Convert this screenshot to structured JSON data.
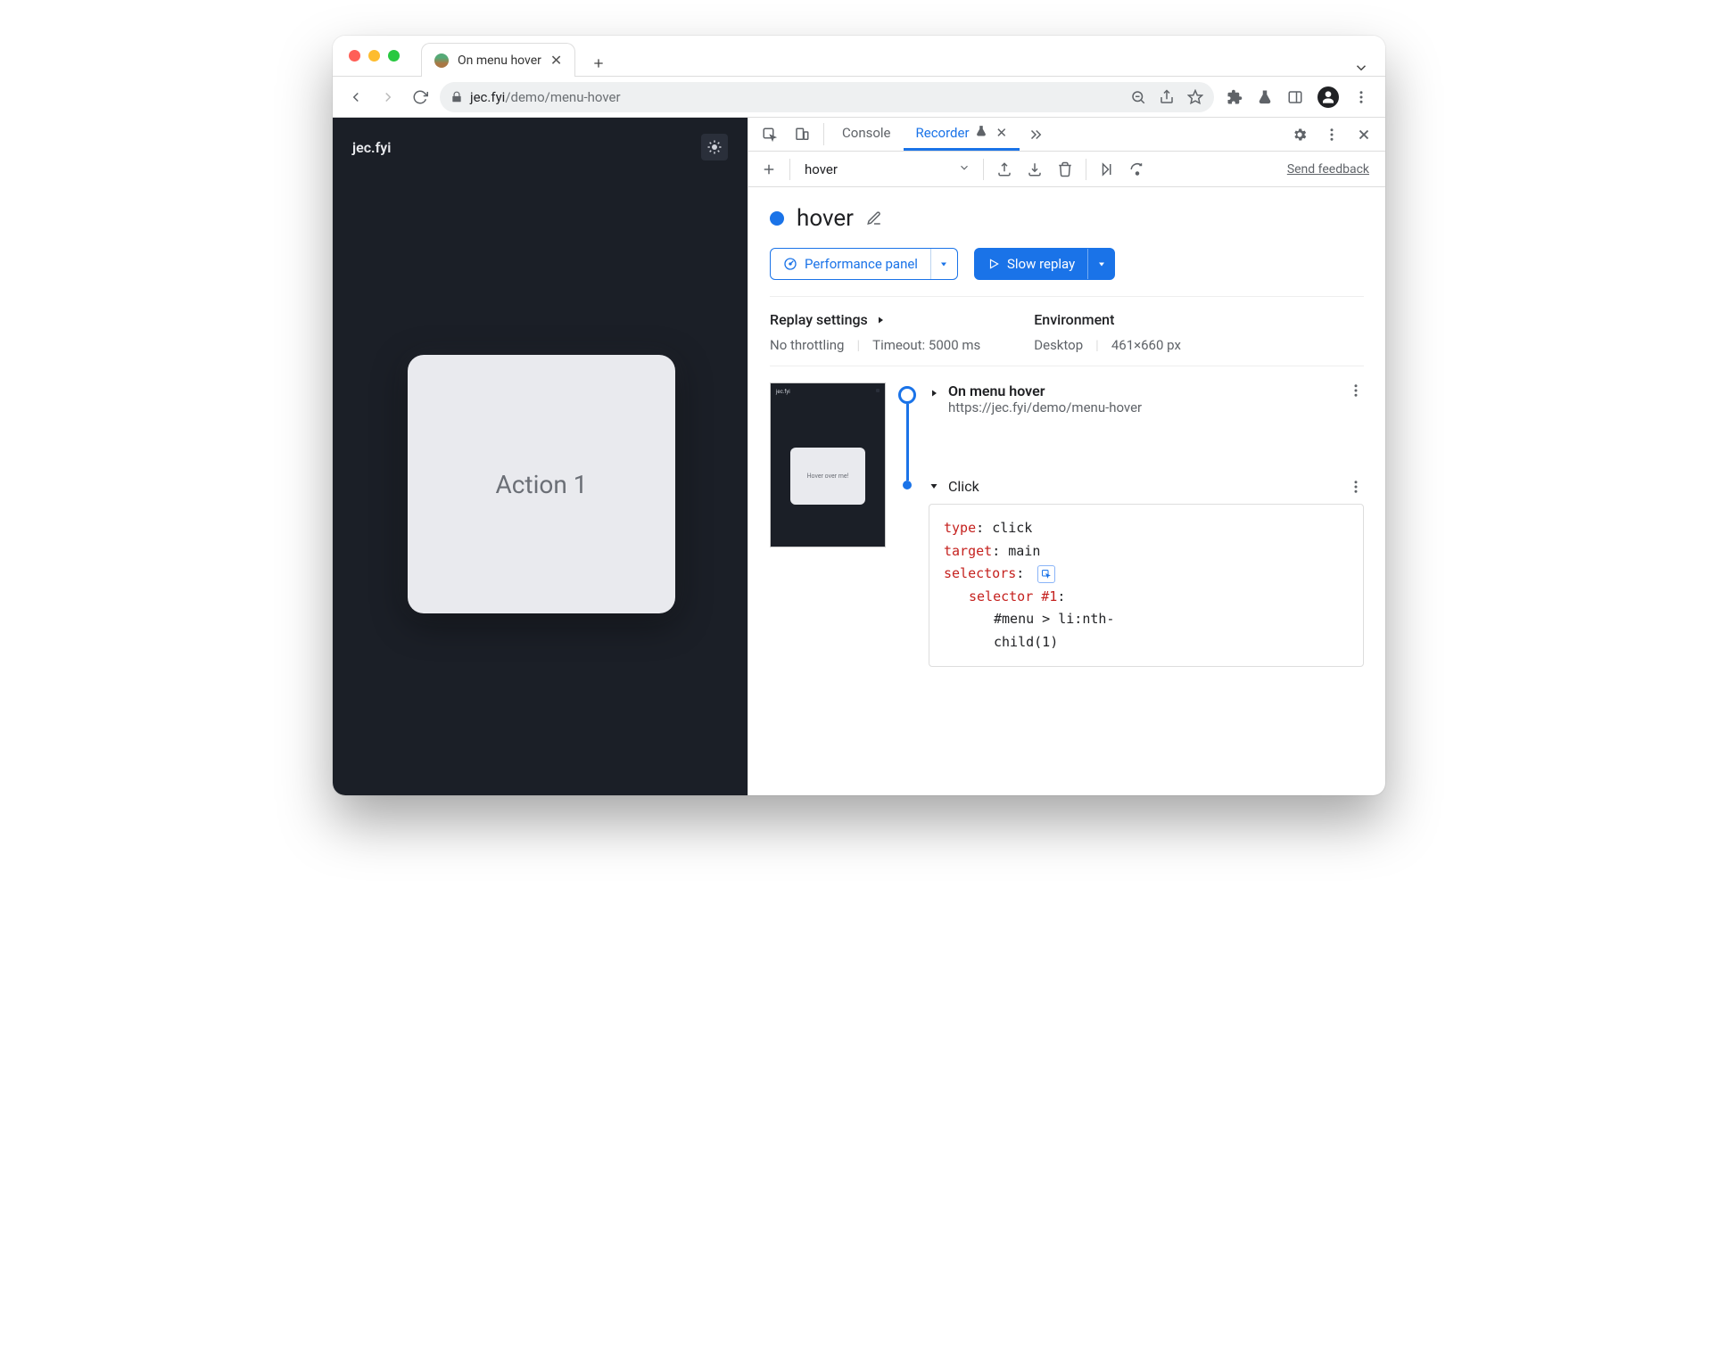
{
  "tab": {
    "title": "On menu hover"
  },
  "url": {
    "domain": "jec.fyi",
    "path": "/demo/menu-hover"
  },
  "page": {
    "brand": "jec.fyi",
    "card_label": "Action 1"
  },
  "devtools": {
    "tabs": {
      "console": "Console",
      "recorder": "Recorder"
    },
    "recorder": {
      "select": "hover",
      "feedback": "Send feedback",
      "title": "hover",
      "perf_btn": "Performance panel",
      "replay_btn": "Slow replay",
      "settings": {
        "replay_heading": "Replay settings",
        "throttling": "No throttling",
        "timeout": "Timeout: 5000 ms",
        "env_heading": "Environment",
        "env_device": "Desktop",
        "env_viewport": "461×660 px"
      },
      "thumb_brand": "jec.fyi",
      "thumb_card": "Hover over me!",
      "step1": {
        "title": "On menu hover",
        "url": "https://jec.fyi/demo/menu-hover"
      },
      "step2": {
        "label": "Click"
      },
      "code": {
        "k_type": "type",
        "v_type": "click",
        "k_target": "target",
        "v_target": "main",
        "k_selectors": "selectors",
        "k_sel1": "selector #1",
        "v_sel1a": "#menu > li:nth-",
        "v_sel1b": "child(1)"
      }
    }
  }
}
